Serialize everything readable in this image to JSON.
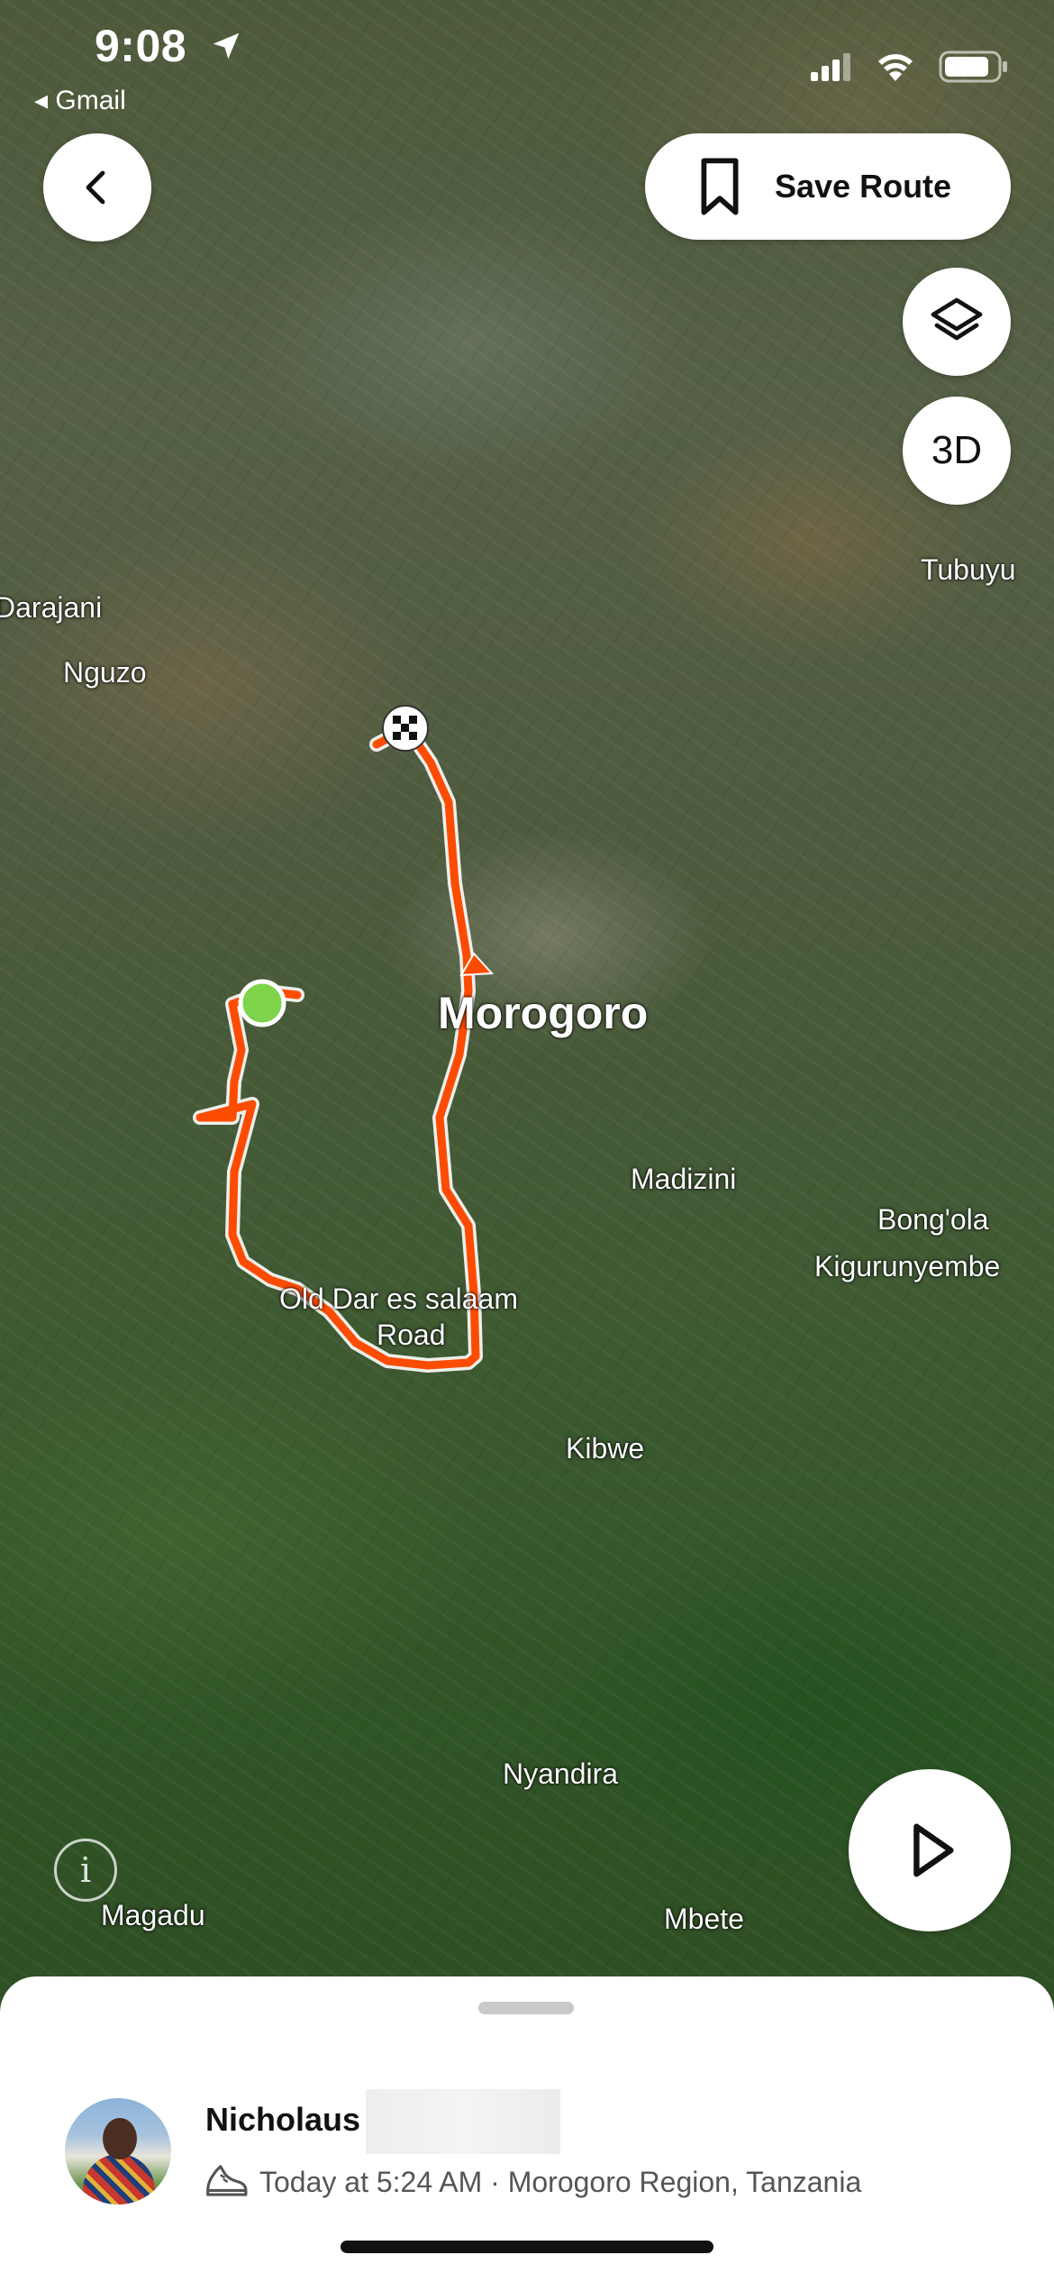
{
  "status_bar": {
    "time": "9:08",
    "back_app": "◂ Gmail"
  },
  "header": {
    "save_route_label": "Save Route",
    "three_d_label": "3D"
  },
  "map": {
    "city_label": "Morogoro",
    "labels": {
      "darajani": "Darajani",
      "nguzo": "Nguzo",
      "tubuyu": "Tubuyu",
      "madizini": "Madizini",
      "bongola": "Bong'ola",
      "kigurunyembe": "Kigurunyembe",
      "old_dar_road_line1": "Old Dar es salaam",
      "old_dar_road_line2": "Road",
      "kibwe": "Kibwe",
      "nyandira": "Nyandira",
      "magadu": "Magadu",
      "mbete": "Mbete"
    },
    "route_color": "#fc4c02",
    "start_marker_color": "#7dd44a"
  },
  "bottom_sheet": {
    "user_name": "Nicholaus",
    "activity_meta": "Today at 5:24 AM · Morogoro Region, Tanzania",
    "activity_icon": "running-shoe-icon"
  }
}
